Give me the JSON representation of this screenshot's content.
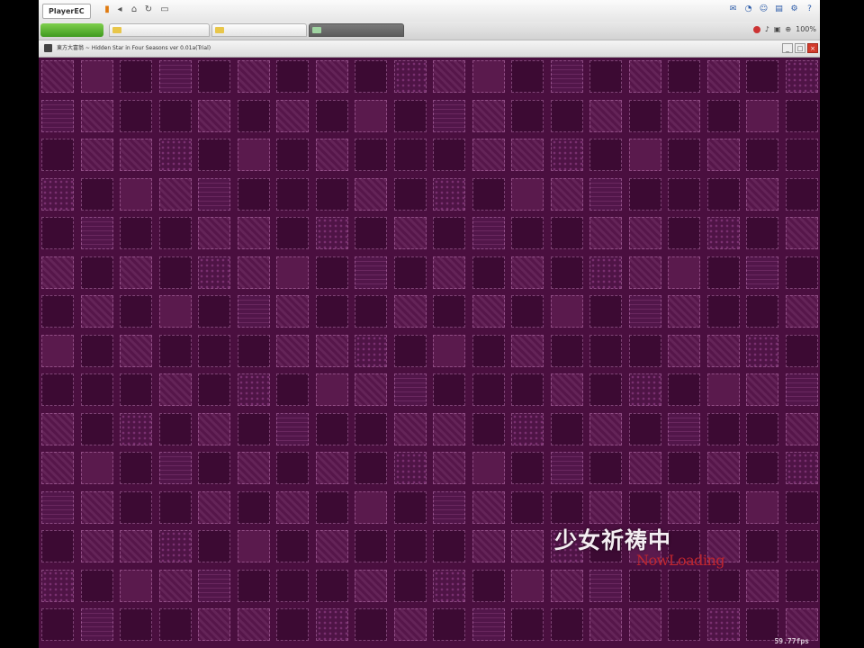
{
  "toolbar": {
    "player_label": "PlayerEC",
    "left_icons": [
      "bookmark-icon",
      "back-icon",
      "home-icon",
      "refresh-icon"
    ],
    "right_icons": [
      "mail-icon",
      "rss-icon",
      "user-icon",
      "chat-icon",
      "tools-icon",
      "help-icon"
    ]
  },
  "tabs": {
    "new_tab_label": "",
    "items": [
      {
        "label": "",
        "active": false
      },
      {
        "label": "",
        "active": false
      },
      {
        "label": "",
        "active": true
      }
    ],
    "tools": [
      "zoom-label"
    ],
    "zoom_label": "100%"
  },
  "window": {
    "title": "東方大富翁 ~ Hidden Star in Four Seasons ver 0.01a(Trial)"
  },
  "game": {
    "loading_text": "少女祈祷中",
    "loading_sub": "NowLoading",
    "fps": "59.77fps",
    "colors": {
      "background": "#4a0f3f",
      "tile_dark": "#3c0a33",
      "loading_sub": "#c0262f"
    }
  }
}
